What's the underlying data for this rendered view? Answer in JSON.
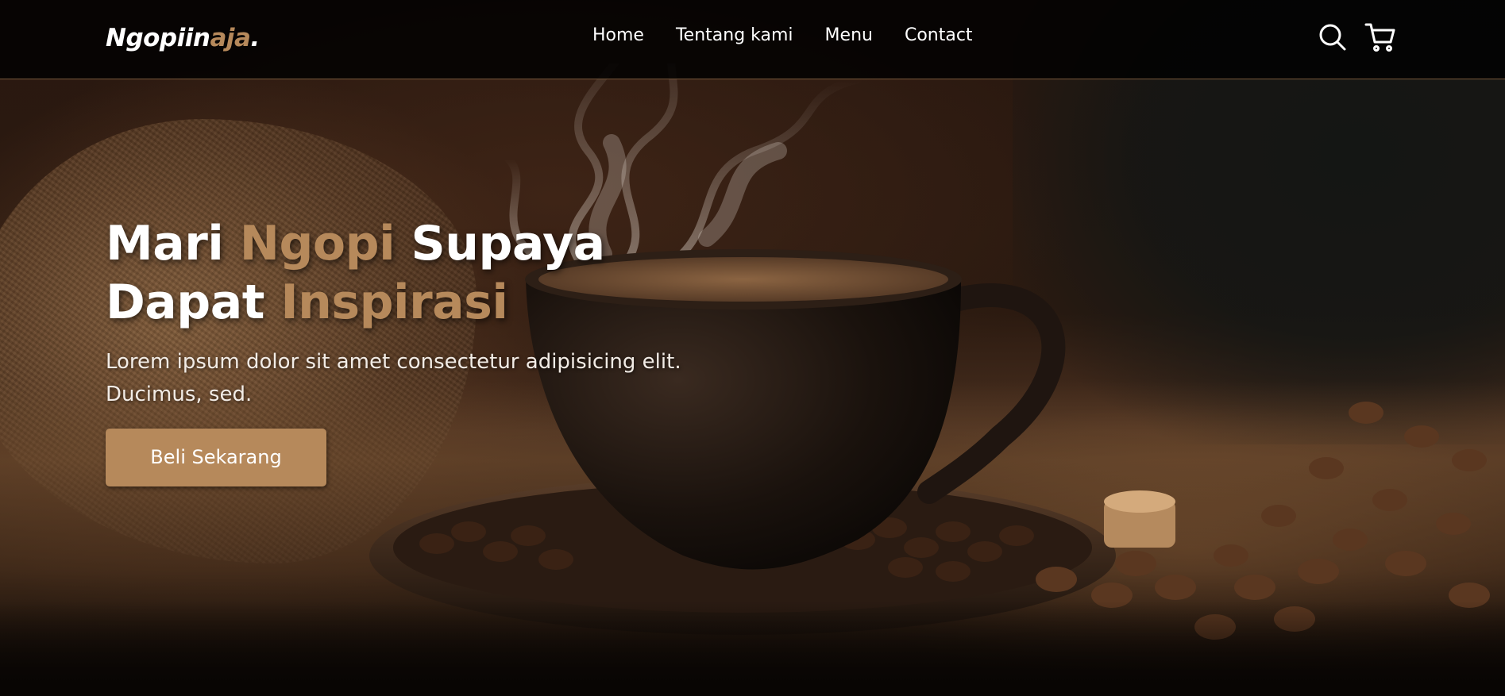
{
  "brand": {
    "name_main": "Ngopiin",
    "name_accent": "aja",
    "name_suffix": "."
  },
  "nav": {
    "links": [
      "Home",
      "Tentang kami",
      "Menu",
      "Contact"
    ],
    "icons": [
      "search-icon",
      "shopping-cart-icon"
    ]
  },
  "hero": {
    "title_parts": [
      "Mari",
      "Ngopi",
      "Supaya",
      "Dapat",
      "Inspirasi"
    ],
    "description_line1": "Lorem ipsum dolor sit amet consectetur adipisicing elit.",
    "description_line2": "Ducimus, sed.",
    "cta_label": "Beli Sekarang"
  },
  "colors": {
    "accent": "#b6895b",
    "navbar_bg": "#010101",
    "text": "#ffffff"
  }
}
